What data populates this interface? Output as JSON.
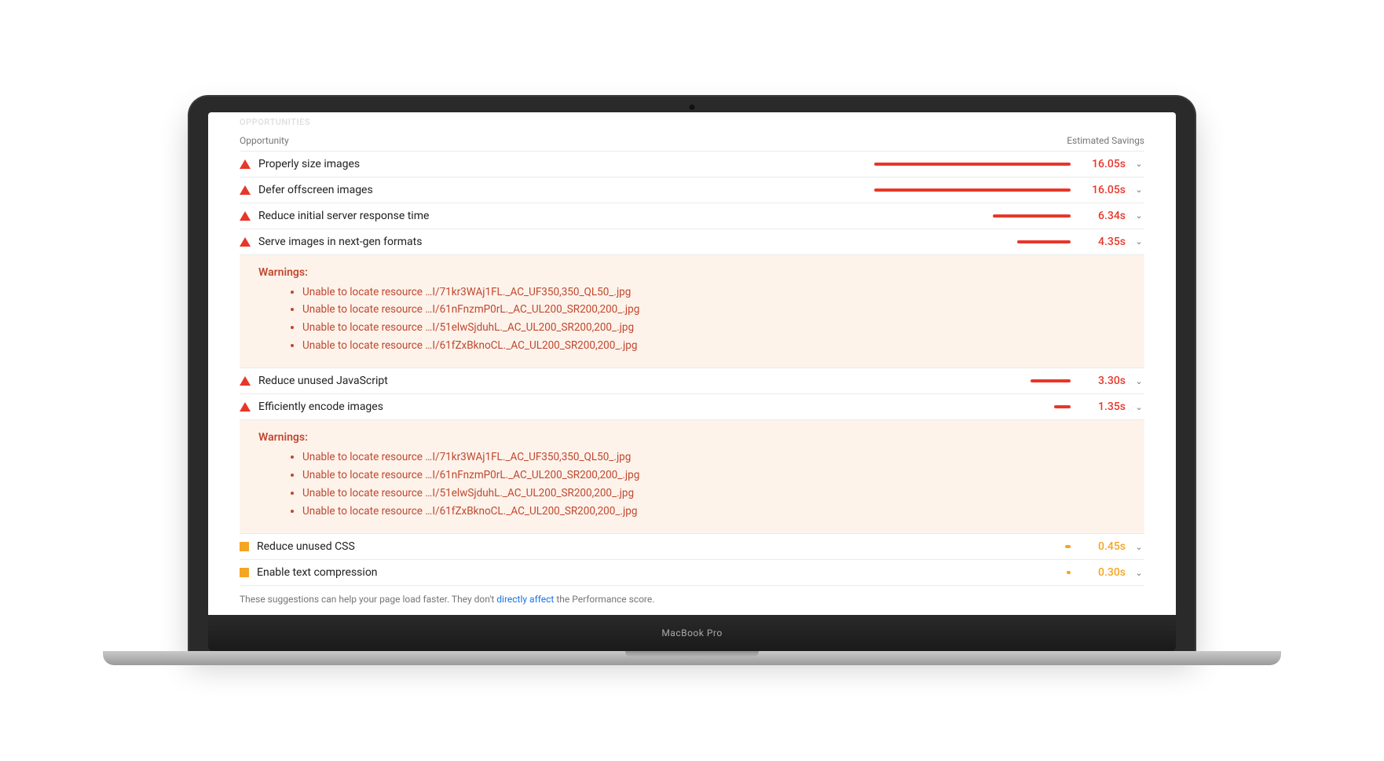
{
  "device_label": "MacBook Pro",
  "section_title": "OPPORTUNITIES",
  "col_opportunity": "Opportunity",
  "col_savings": "Estimated Savings",
  "max_bar_seconds": 16.05,
  "opportunities": [
    {
      "label": "Properly size images",
      "value": "16.05s",
      "seconds": 16.05,
      "severity": "red"
    },
    {
      "label": "Defer offscreen images",
      "value": "16.05s",
      "seconds": 16.05,
      "severity": "red"
    },
    {
      "label": "Reduce initial server response time",
      "value": "6.34s",
      "seconds": 6.34,
      "severity": "red"
    },
    {
      "label": "Serve images in next-gen formats",
      "value": "4.35s",
      "seconds": 4.35,
      "severity": "red",
      "warnings": true
    },
    {
      "label": "Reduce unused JavaScript",
      "value": "3.30s",
      "seconds": 3.3,
      "severity": "red"
    },
    {
      "label": "Efficiently encode images",
      "value": "1.35s",
      "seconds": 1.35,
      "severity": "red",
      "warnings": true
    },
    {
      "label": "Reduce unused CSS",
      "value": "0.45s",
      "seconds": 0.45,
      "severity": "orange"
    },
    {
      "label": "Enable text compression",
      "value": "0.30s",
      "seconds": 0.3,
      "severity": "orange"
    }
  ],
  "warnings_title": "Warnings:",
  "warnings_items": [
    "Unable to locate resource …I/71kr3WAj1FL._AC_UF350,350_QL50_.jpg",
    "Unable to locate resource …I/61nFnzmP0rL._AC_UL200_SR200,200_.jpg",
    "Unable to locate resource …I/51elwSjduhL._AC_UL200_SR200,200_.jpg",
    "Unable to locate resource …I/61fZxBknoCL._AC_UL200_SR200,200_.jpg"
  ],
  "footer_prefix": "These suggestions can help your page load faster. They don't ",
  "footer_link": "directly affect",
  "footer_suffix": " the Performance score."
}
